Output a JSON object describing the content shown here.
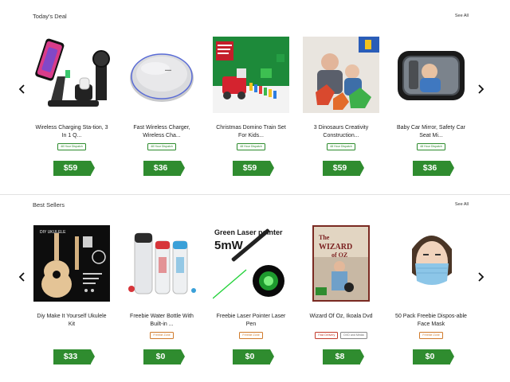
{
  "todays_deal": {
    "heading": "Today's Deal",
    "see_all": "See All",
    "items": [
      {
        "title": "Wireless Charging Sta-tion, 3 In 1 Q...",
        "badges": [
          {
            "text": "48 Hour Dispatch",
            "color": "green"
          }
        ],
        "price": "$59",
        "icon": "wireless-charging-station-image"
      },
      {
        "title": "Fast Wireless Charger, Wireless Cha...",
        "badges": [
          {
            "text": "48 Hour Dispatch",
            "color": "green"
          }
        ],
        "price": "$36",
        "icon": "wireless-charger-pad-image"
      },
      {
        "title": "Christmas Domino Train Set For Kids...",
        "badges": [
          {
            "text": "48 Hour Dispatch",
            "color": "green"
          }
        ],
        "price": "$59",
        "icon": "domino-train-image"
      },
      {
        "title": "3 Dinosaurs Creativity Construction...",
        "badges": [
          {
            "text": "48 Hour Dispatch",
            "color": "green"
          }
        ],
        "price": "$59",
        "icon": "dinosaur-toys-image"
      },
      {
        "title": "Baby Car Mirror, Safety Car Seat Mi...",
        "badges": [
          {
            "text": "48 Hour Dispatch",
            "color": "green"
          }
        ],
        "price": "$36",
        "icon": "baby-car-mirror-image"
      }
    ]
  },
  "best_sellers": {
    "heading": "Best Sellers",
    "see_all": "See All",
    "items": [
      {
        "title": "Diy Make It Yourself Ukulele Kit",
        "badges": [],
        "price": "$33",
        "icon": "ukulele-kit-image",
        "image_text": "DIY UKULELE"
      },
      {
        "title": "Freebie Water Bottle With Built-in ...",
        "badges": [
          {
            "text": "Freebie Zone",
            "color": "orange"
          }
        ],
        "price": "$0",
        "icon": "water-bottle-image"
      },
      {
        "title": "Freebie Laser Pointer Laser Pen",
        "badges": [
          {
            "text": "Freebie Zone",
            "color": "orange"
          }
        ],
        "price": "$0",
        "icon": "laser-pointer-image",
        "image_text": "Green Laser pointer",
        "image_text2": "5mW"
      },
      {
        "title": "Wizard Of Oz, Ikoala Dvd",
        "badges": [
          {
            "text": "Fast Delivery",
            "color": "red"
          },
          {
            "text": "DVD and Media",
            "color": "grey"
          }
        ],
        "price": "$8",
        "icon": "wizard-of-oz-dvd-image"
      },
      {
        "title": "50 Pack Freebie Dispos-able Face Mask",
        "badges": [
          {
            "text": "Freebie Zone",
            "color": "orange"
          }
        ],
        "price": "$0",
        "icon": "face-mask-image"
      }
    ]
  },
  "colors": {
    "price_green": "#2f8c2f",
    "badge_green": "#2a8a2a",
    "badge_red": "#c23a2a",
    "badge_orange": "#d07a2a"
  }
}
